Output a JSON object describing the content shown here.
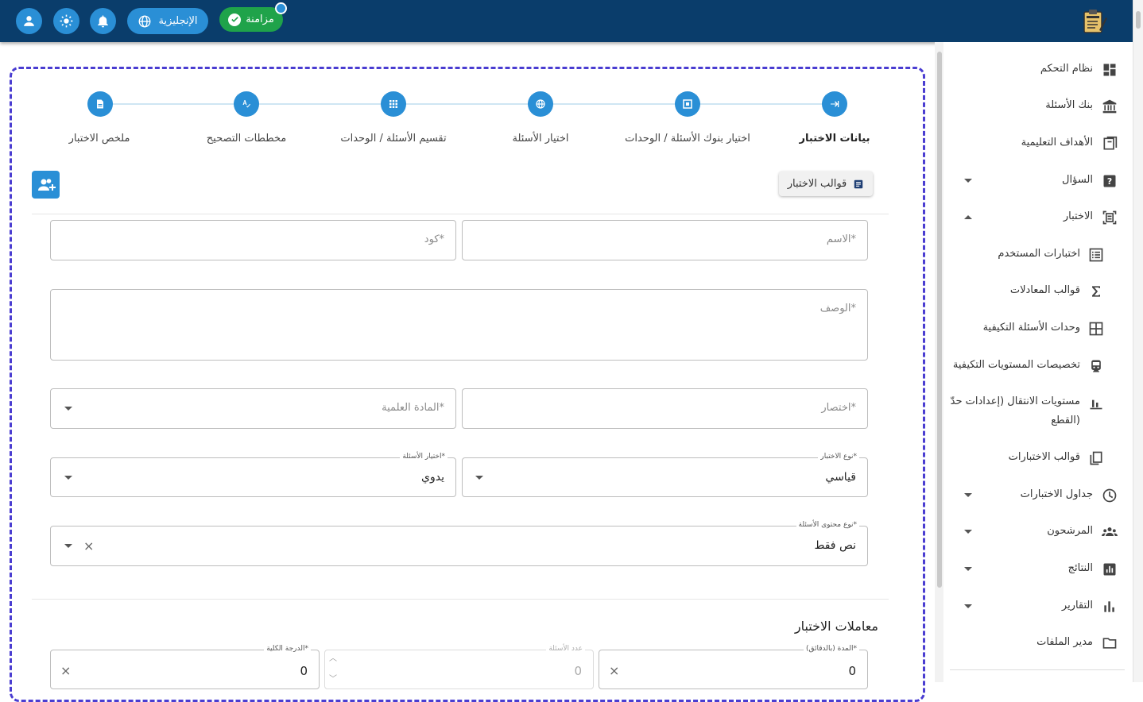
{
  "topbar": {
    "sync_label": "مزامنة",
    "language_label": "الإنجليزية",
    "logo_icon": "exam-clipboard-logo",
    "profile_icon": "person-icon",
    "theme_icon": "sun-icon",
    "notifications_icon": "bell-icon",
    "brand_color": "#0a3d6b",
    "accent_color": "#2a8fd6",
    "sync_color": "#1fa34a"
  },
  "sidebar": {
    "items": [
      {
        "label": "نظام التحكم",
        "icon": "dashboard-icon"
      },
      {
        "label": "بنك الأسئلة",
        "icon": "bank-icon"
      },
      {
        "label": "الأهداف التعليمية",
        "icon": "book-icon"
      },
      {
        "label": "السؤال",
        "icon": "question-icon"
      },
      {
        "label": "الاختبار",
        "icon": "exam-icon"
      },
      {
        "label": "اختبارات المستخدم",
        "icon": "list-icon"
      },
      {
        "label": "قوالب المعادلات",
        "icon": "sigma-icon"
      },
      {
        "label": "وحدات الأسئلة التكيفية",
        "icon": "grid-icon"
      },
      {
        "label": "تخصيصات المستويات التكيفية",
        "icon": "train-icon"
      },
      {
        "label": "مستويات الانتقال (إعدادات حدّ",
        "label2": "القطع)",
        "icon": "bar-icon"
      },
      {
        "label": "قوالب الاختبارات",
        "icon": "copy-icon"
      },
      {
        "label": "جداول الاختبارات",
        "icon": "clock-icon"
      },
      {
        "label": "المرشحون",
        "icon": "people-icon"
      },
      {
        "label": "النتائج",
        "icon": "results-icon"
      },
      {
        "label": "التقارير",
        "icon": "chart-icon"
      },
      {
        "label": "مدير الملفات",
        "icon": "folder-icon"
      }
    ]
  },
  "stepper": {
    "steps": [
      {
        "label": "بيانات الاختبار",
        "icon": "arrow-right-to-line-icon"
      },
      {
        "label": "اختيار بنوك الأسئلة / الوحدات",
        "icon": "frame-icon"
      },
      {
        "label": "اختيار الأسئلة",
        "icon": "globe-icon"
      },
      {
        "label": "تقسيم الأسئلة / الوحدات",
        "icon": "apps-grid-icon"
      },
      {
        "label": "مخططات التصحيح",
        "icon": "spellcheck-icon"
      },
      {
        "label": "ملخص الاختبار",
        "icon": "document-icon"
      }
    ]
  },
  "actions": {
    "templates_label": "قوالب الاختبار",
    "templates_icon": "list-box-icon",
    "add_user_icon": "add-user-icon"
  },
  "form": {
    "name_placeholder": "الاسم*",
    "code_placeholder": "كود*",
    "description_placeholder": "الوصف*",
    "abbreviation_placeholder": "اختصار*",
    "subject_placeholder": "المادة العلمية*",
    "exam_type_label": "نوع الاختبار*",
    "exam_type_value": "قياسي",
    "question_selection_label": "اختيار الأسئلة*",
    "question_selection_value": "يدوي",
    "content_type_label": "نوع محتوى الأسئلة*",
    "content_type_value": "نص فقط"
  },
  "parameters": {
    "title": "معاملات الاختبار",
    "duration_label": "المدة (بالدقائق)*",
    "duration_value": "0",
    "question_count_label": "عدد الأسئلة",
    "question_count_value": "0",
    "total_grade_label": "الدرجة الكلية*",
    "total_grade_value": "0"
  }
}
